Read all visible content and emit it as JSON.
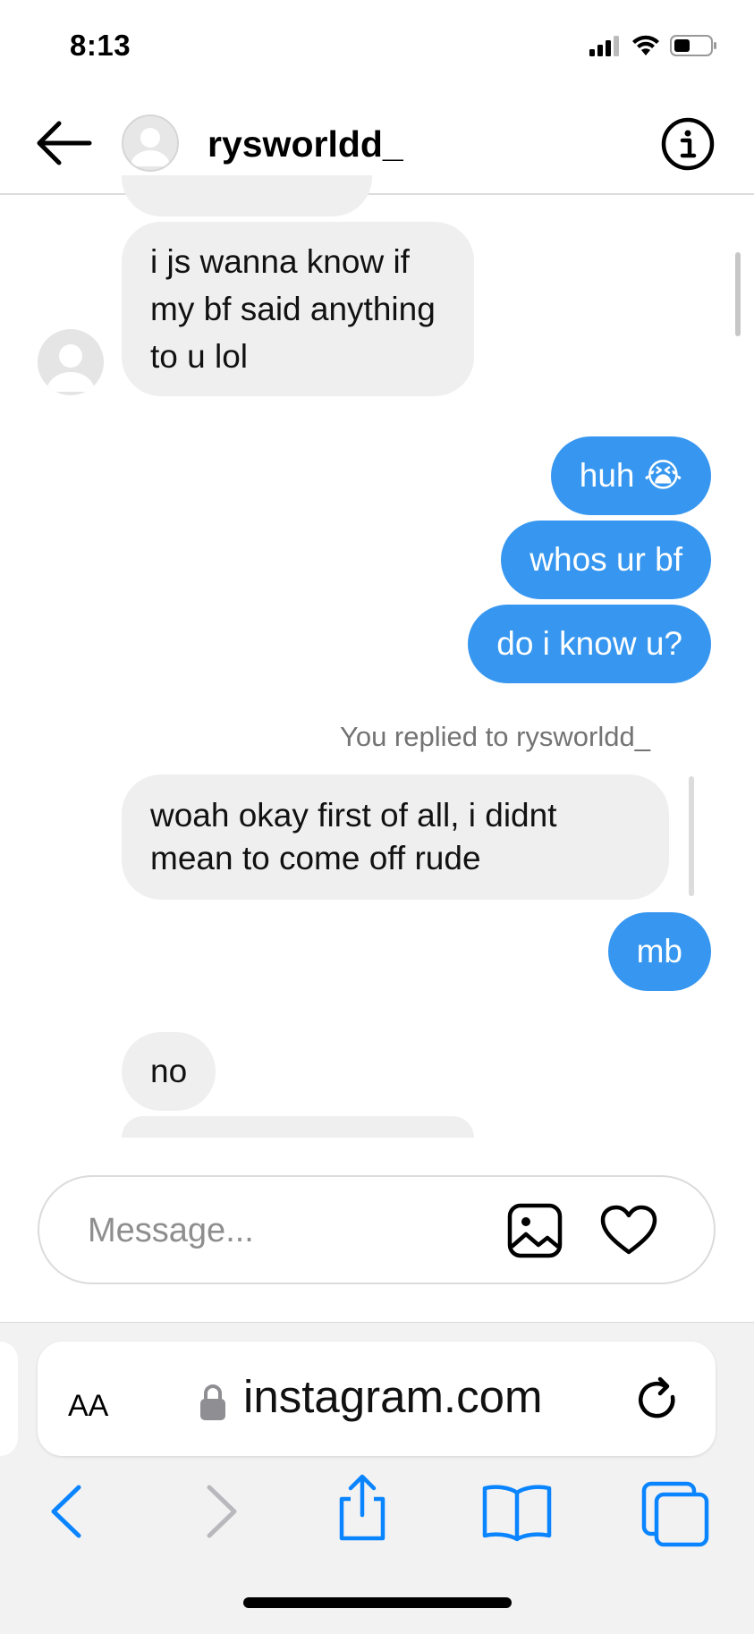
{
  "status_bar": {
    "time": "8:13"
  },
  "header": {
    "username": "rysworldd_"
  },
  "messages": {
    "incoming_1": "i js wanna know if my bf said anything to u lol",
    "outgoing_1": "huh 😭",
    "outgoing_2": "whos ur bf",
    "outgoing_3": "do i know u?",
    "replied_label": "You replied to rysworldd_",
    "incoming_2": "woah okay first of all, i didnt mean to come off rude",
    "outgoing_4": "mb",
    "incoming_3": "no"
  },
  "composer": {
    "placeholder": "Message..."
  },
  "browser": {
    "aa_label": "AA",
    "url": "instagram.com"
  },
  "colors": {
    "outgoing_bubble": "#3797f0",
    "incoming_bubble": "#efefef",
    "safari_blue": "#0a84ff"
  },
  "icons": [
    "back-arrow-icon",
    "info-icon",
    "gallery-icon",
    "heart-icon",
    "lock-icon",
    "reload-icon",
    "safari-back-icon",
    "safari-forward-icon",
    "share-icon",
    "bookmarks-icon",
    "tabs-icon"
  ]
}
